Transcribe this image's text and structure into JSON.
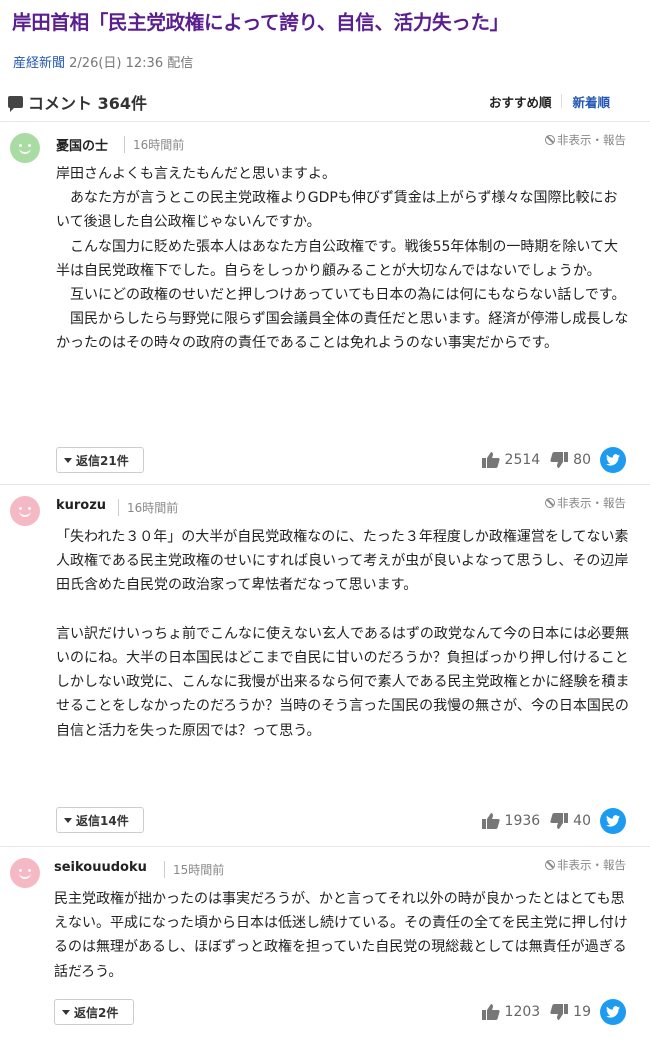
{
  "article": {
    "title": "岸田首相「民主党政権によって誇り、自信、活力失った」",
    "source": "産経新聞",
    "date": "2/26(日) 12:36 配信"
  },
  "comments_header": {
    "title": "コメント 364件",
    "sort_recommended": "おすすめ順",
    "sort_newest": "新着順"
  },
  "comments": [
    {
      "user": "憂国の士",
      "time": "16時間前",
      "report": "非表示・報告",
      "avatar": "green-smiley",
      "lines": [
        "岸田さんよくも言えたもんだと思いますよ。",
        "　あなた方が言うとこの民主党政権よりGDPも伸びず賃金は上がらず様々な国際比較において後退した自公政権じゃないんですか。",
        "　こんな国力に貶めた張本人はあなた方自公政権です。戦後55年体制の一時期を除いて大半は自民党政権下でした。自らをしっかり顧みることが大切なんではないでしょうか。",
        "　互いにどの政権のせいだと押しつけあっていても日本の為には何にもならない話しです。",
        "　国民からしたら与野党に限らず国会議員全体の責任だと思います。経済が停滞し成長しなかったのはその時々の政府の責任であることは免れようのない事実だからです。"
      ],
      "replies": "返信21件",
      "likes": "2514",
      "dislikes": "80"
    },
    {
      "user": "kurozu",
      "time": "16時間前",
      "report": "非表示・報告",
      "avatar": "pink-smiley",
      "lines": [
        "「失われた３０年」の大半が自民党政権なのに、たった３年程度しか政権運営をしてない素人政権である民主党政権のせいにすれば良いって考えが虫が良いよなって思うし、その辺岸田氏含めた自民党の政治家って卑怯者だなって思います。",
        "",
        "言い訳だけいっちょ前でこんなに使えない玄人であるはずの政党なんて今の日本には必要無いのにね。大半の日本国民はどこまで自民に甘いのだろうか？負担ばっかり押し付けることしかしない政党に、こんなに我慢が出来るなら何で素人である民主党政権とかに経験を積ませることをしなかったのだろうか？当時のそう言った国民の我慢の無さが、今の日本国民の自信と活力を失った原因では？って思う。"
      ],
      "replies": "返信14件",
      "likes": "1936",
      "dislikes": "40"
    },
    {
      "user": "seikouudoku",
      "time": "15時間前",
      "report": "非表示・報告",
      "avatar": "pink-smiley",
      "lines": [
        "民主党政権が拙かったのは事実だろうが、かと言ってそれ以外の時が良かったとはとても思えない。平成になった頃から日本は低迷し続けている。その責任の全てを民主党に押し付けるのは無理があるし、ほぼずっと政権を担っていた自民党の現総裁としては無責任が過ぎる話だろう。"
      ],
      "replies": "返信2件",
      "likes": "1203",
      "dislikes": "19"
    }
  ],
  "colors": {
    "headline": "#5a1f8f",
    "link": "#2458b3",
    "twitter": "#1d9bf0"
  }
}
